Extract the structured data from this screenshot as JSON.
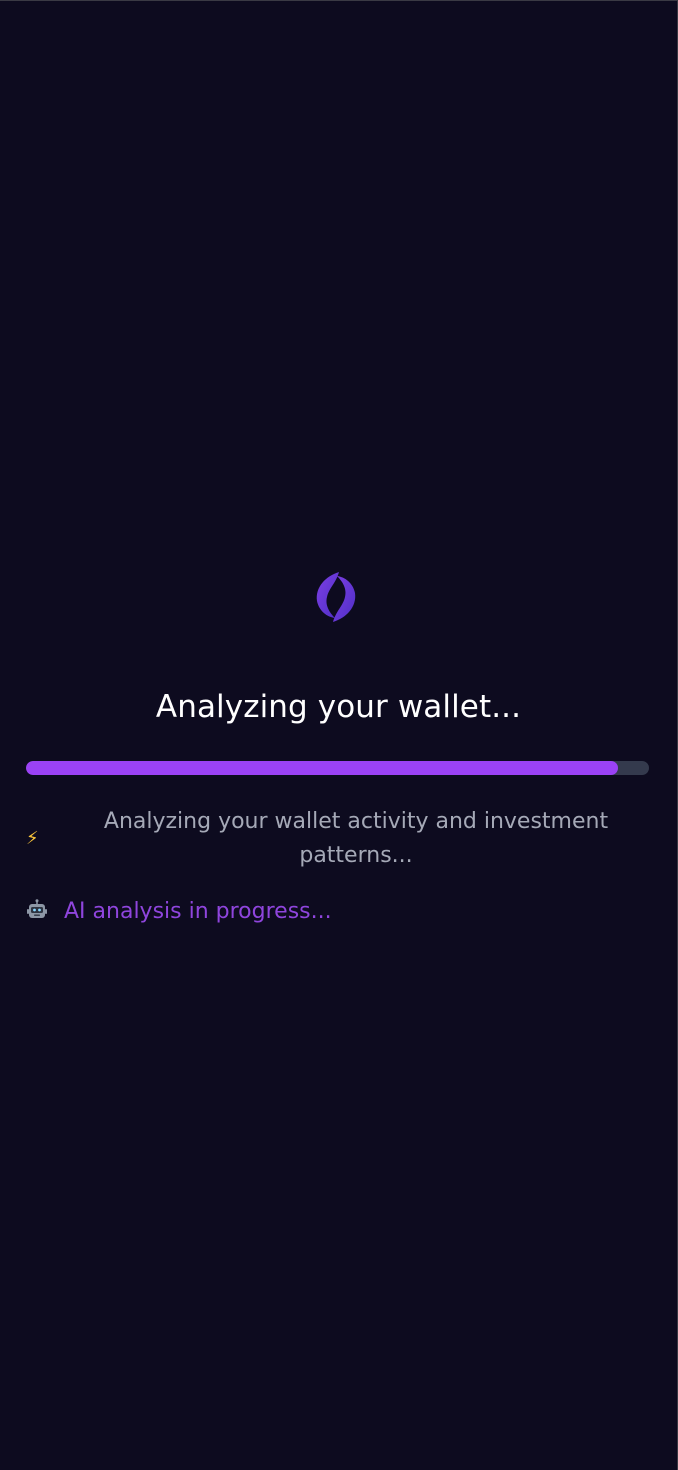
{
  "loading": {
    "title": "Analyzing your wallet...",
    "progress_percent": 95,
    "status_message": "Analyzing your wallet activity and investment patterns...",
    "status_icon": "lightning-icon",
    "secondary_message": "AI analysis in progress...",
    "secondary_icon": "robot-icon"
  },
  "colors": {
    "background": "#0d0b1f",
    "accent": "#9b42f5",
    "track": "#343a4d",
    "text_primary": "#ffffff",
    "text_muted": "#a5a9b7",
    "ai_text": "#8f45dd"
  }
}
